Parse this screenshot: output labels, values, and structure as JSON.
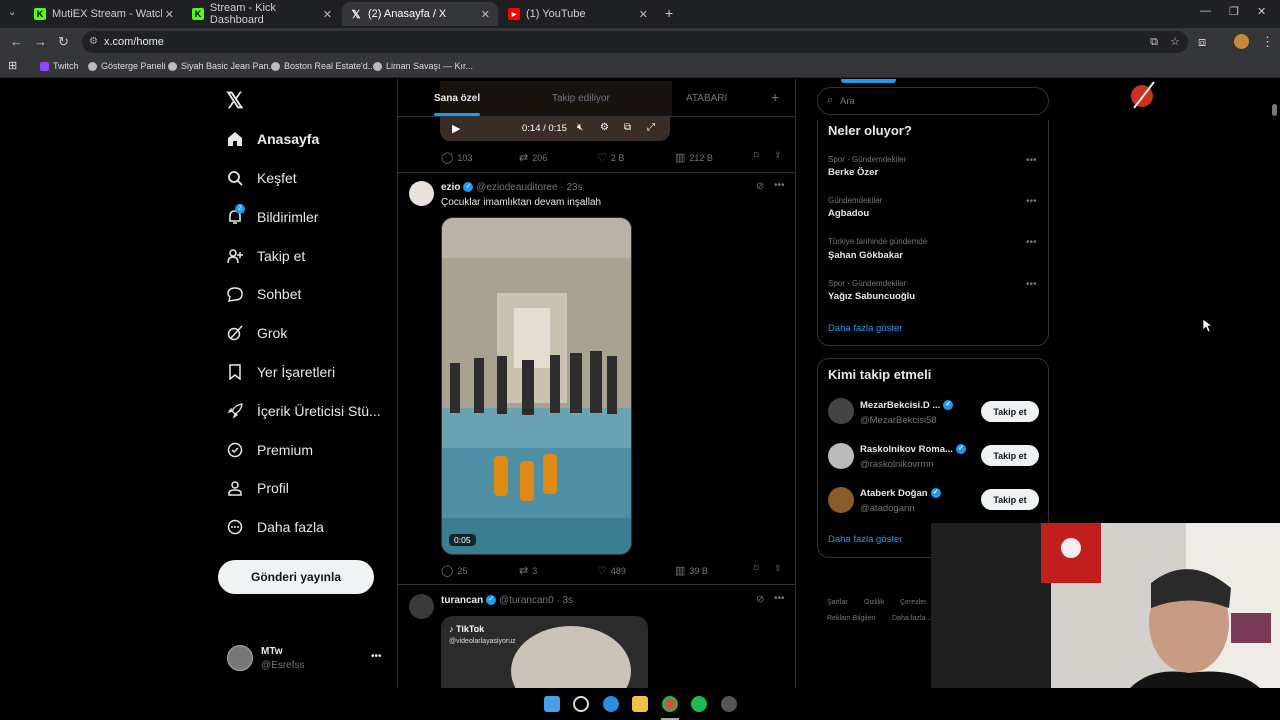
{
  "browser": {
    "tabs": [
      {
        "title": "MutiEX Stream - Watch Live on",
        "favicon": "kick-icon",
        "color": "#53fc18"
      },
      {
        "title": "Stream - Kick Dashboard",
        "favicon": "kick-icon",
        "color": "#53fc18"
      },
      {
        "title": "(2) Anasayfa / X",
        "favicon": "x-icon",
        "color": "#ffffff"
      },
      {
        "title": "(1) YouTube",
        "favicon": "youtube-icon",
        "color": "#ff0000"
      }
    ],
    "url": "x.com/home",
    "bookmarks": [
      "Twitch",
      "Gösterge Paneli",
      "Siyah Basic Jean Pan...",
      "Boston Real Estate'd...",
      "Liman Savaşı — Kır..."
    ]
  },
  "nav": {
    "items": [
      {
        "label": "Anasayfa",
        "icon": "home-icon"
      },
      {
        "label": "Keşfet",
        "icon": "search-icon"
      },
      {
        "label": "Bildirimler",
        "icon": "bell-icon",
        "badge": "2"
      },
      {
        "label": "Takip et",
        "icon": "person-add-icon"
      },
      {
        "label": "Sohbet",
        "icon": "chat-icon"
      },
      {
        "label": "Grok",
        "icon": "grok-icon"
      },
      {
        "label": "Yer İşaretleri",
        "icon": "bookmark-icon"
      },
      {
        "label": "İçerik Üreticisi Stü...",
        "icon": "rocket-icon"
      },
      {
        "label": "Premium",
        "icon": "premium-icon"
      },
      {
        "label": "Profil",
        "icon": "profile-icon"
      },
      {
        "label": "Daha fazla",
        "icon": "more-circle-icon"
      }
    ],
    "post_button": "Gönderi yayınla",
    "account": {
      "name": "MTw",
      "handle": "@Esrefss"
    }
  },
  "timeline": {
    "tabs": [
      "Sana özel",
      "Takip ediliyor",
      "ATABARI"
    ],
    "prev_post": {
      "video_time": "0:14 / 0:15",
      "replies": "103",
      "reposts": "206",
      "likes": "2 B",
      "views": "212 B"
    },
    "post1": {
      "name": "ezio",
      "handle": "@eziodeauditoree",
      "time": "· 23s",
      "text": "Çocuklar imamlıktan devam inşallah",
      "video_duration": "0:05",
      "replies": "25",
      "reposts": "3",
      "likes": "489",
      "views": "39 B"
    },
    "post2": {
      "name": "turancan",
      "handle": "@turancan0",
      "time": "· 3s",
      "tiktok_label": "TikTok",
      "tiktok_handle": "@videolarlayasiyoruz"
    }
  },
  "sidebar": {
    "search_placeholder": "Ara",
    "trends_title": "Neler oluyor?",
    "trends": [
      {
        "category": "Spor · Gündemdekiler",
        "name": "Berke Özer"
      },
      {
        "category": "Gündemdekiler",
        "name": "Agbadou"
      },
      {
        "category": "Türkiye tarihinde gündemde",
        "name": "Şahan Gökbakar"
      },
      {
        "category": "Spor · Gündemdekiler",
        "name": "Yağız Sabuncuoğlu"
      }
    ],
    "trends_more": "Daha fazla göster",
    "wtf_title": "Kimi takip etmeli",
    "who_to_follow": [
      {
        "name": "MezarBekcisi.D ...",
        "handle": "@MezarBekcisi58",
        "button": "Takip et"
      },
      {
        "name": "Raskolnikov Roma...",
        "handle": "@raskolnikovrmn",
        "button": "Takip et"
      },
      {
        "name": "Ataberk Doğan",
        "handle": "@atadogann",
        "button": "Takip et"
      }
    ],
    "wtf_more": "Daha fazla göster",
    "footer": [
      "Şartlar",
      "Gizlilik",
      "Çerezler",
      "Reklam Bilgileri",
      "Daha fazla ..."
    ]
  },
  "colors": {
    "accent": "#1d9bf0",
    "bg": "#000000",
    "border": "#2f3336",
    "muted": "#71767b"
  }
}
